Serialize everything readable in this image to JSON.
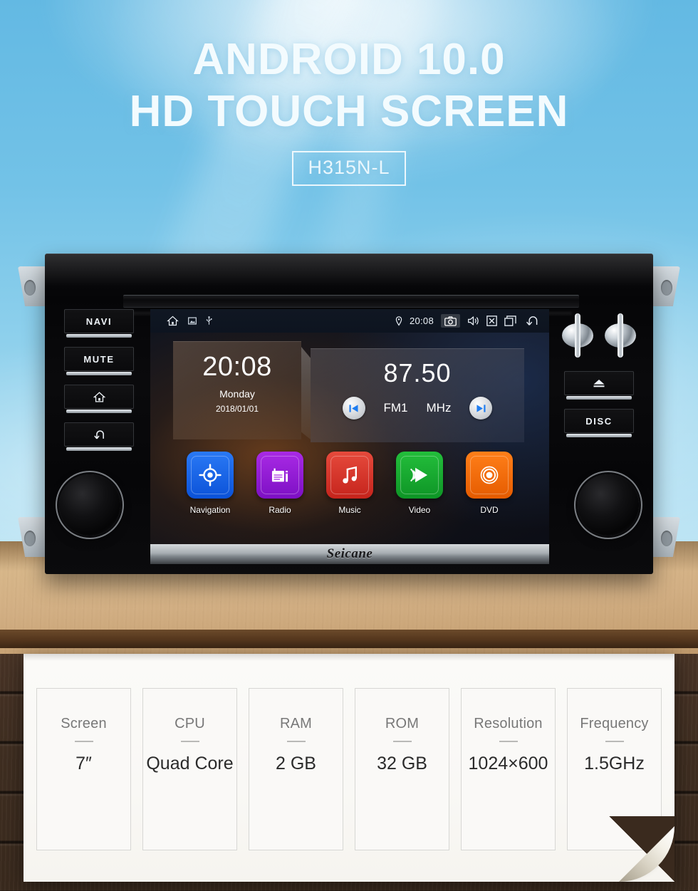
{
  "hero": {
    "line1": "ANDROID 10.0",
    "line2": "HD TOUCH SCREEN",
    "model_badge": "H315N-L"
  },
  "device": {
    "brand": "Seicane",
    "left_buttons": [
      {
        "label": "NAVI",
        "icon": ""
      },
      {
        "label": "MUTE",
        "icon": ""
      },
      {
        "label": "",
        "icon": "home-icon"
      },
      {
        "label": "",
        "icon": "back-icon"
      }
    ],
    "right_buttons": [
      {
        "label": "",
        "icon": "eject-icon"
      },
      {
        "label": "DISC",
        "icon": ""
      }
    ],
    "knob_left": "volume-knob",
    "knob_right": "tune-knob"
  },
  "statusbar": {
    "left_icons": [
      "home-icon",
      "image-icon",
      "usb-icon"
    ],
    "location_icon": "location-pin-icon",
    "time": "20:08",
    "right_icons": [
      "camera-icon",
      "volume-icon",
      "close-box-icon",
      "recents-icon",
      "back-icon"
    ]
  },
  "clock_widget": {
    "time": "20:08",
    "weekday": "Monday",
    "date": "2018/01/01"
  },
  "radio_widget": {
    "frequency": "87.50",
    "band": "FM1",
    "unit": "MHz",
    "prev_icon": "skip-previous-icon",
    "next_icon": "skip-next-icon"
  },
  "apps": [
    {
      "name": "Navigation",
      "color": "#1565e8",
      "icon": "navigation-target-icon"
    },
    {
      "name": "Radio",
      "color": "#9a1fd6",
      "icon": "radio-icon"
    },
    {
      "name": "Music",
      "color": "#d8362b",
      "icon": "music-note-icon"
    },
    {
      "name": "Video",
      "color": "#16a62e",
      "icon": "video-play-icon"
    },
    {
      "name": "DVD",
      "color": "#f26a00",
      "icon": "dvd-disc-icon"
    }
  ],
  "specs": [
    {
      "label": "Screen",
      "value": "7″"
    },
    {
      "label": "CPU",
      "value": "Quad Core"
    },
    {
      "label": "RAM",
      "value": "2 GB"
    },
    {
      "label": "ROM",
      "value": "32 GB"
    },
    {
      "label": "Resolution",
      "value": "1024×600"
    },
    {
      "label": "Frequency",
      "value": "1.5GHz"
    }
  ],
  "colors": {
    "sky_top": "#63b9e3",
    "sky_bottom": "#c9e9f6",
    "panel_bg": "#faf9f7",
    "wood_light": "#d3b085",
    "wood_dark": "#412f22"
  }
}
